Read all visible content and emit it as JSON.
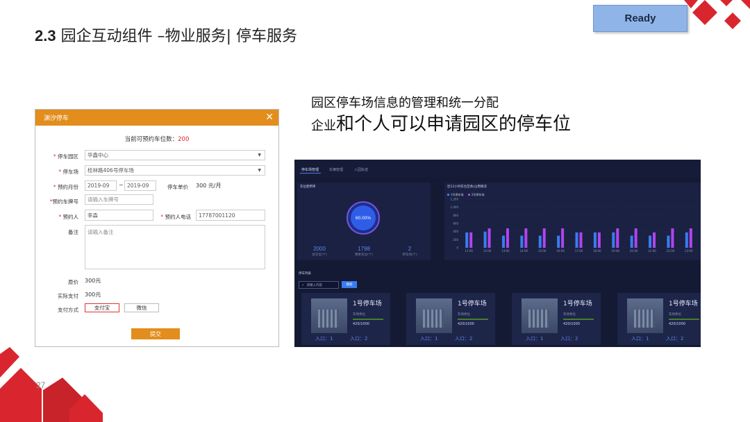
{
  "slide": {
    "title_prefix": "2.3",
    "title_text": "园企互动组件 –物业服务| 停车服务",
    "ready_label": "Ready",
    "desc_line1": "园区停车场信息的管理和统一分配",
    "desc_line2_small": "企业",
    "desc_line2_large": "和个人可以申请园区的停车位",
    "page_number": "27"
  },
  "dialog": {
    "title": "渊汐停车",
    "close": "✕",
    "available_label": "当前可预约车位数：",
    "available_count": "200",
    "park_label": "停车园区",
    "park_value": "华鑫中心",
    "lot_label": "停车场",
    "lot_value": "桂林路406号停车场",
    "month_label": "预约月份",
    "month_from": "2019-09",
    "month_sep": "~",
    "month_to": "2019-09",
    "price_label": "停车单价",
    "price_value": "300 元/月",
    "plate_label": "预约车牌号",
    "plate_placeholder": "请输入车牌号",
    "person_label": "预约人",
    "person_value": "李森",
    "phone_label": "预约人电话",
    "phone_value": "17787001120",
    "note_label": "备注",
    "note_placeholder": "请输入备注",
    "original_price_label": "原价",
    "original_price_value": "300元",
    "actual_pay_label": "实际支付",
    "actual_pay_value": "300元",
    "pay_method_label": "支付方式",
    "pay_alipay": "支付宝",
    "pay_wechat": "微信",
    "submit_label": "提交",
    "required_mark": "*"
  },
  "dashboard": {
    "tabs": [
      "停车场管理",
      "车辆管理",
      "入园轨迹"
    ],
    "usage_panel_title": "车位使用率",
    "usage_percent": "60.00%",
    "stats": [
      {
        "value": "2000",
        "label": "总车位(个)"
      },
      {
        "value": "1798",
        "label": "剩余车位(个)"
      },
      {
        "value": "2",
        "label": "停车场(个)"
      }
    ],
    "chart_title": "近12小时车位空余/占用情况",
    "list_title": "停车列表",
    "search_placeholder": "请输入内容",
    "search_button": "搜索",
    "cards": [
      {
        "name": "1号停车场",
        "sub": "车场余位",
        "value": "420/1000",
        "in": "入口：1",
        "out": "入口：2"
      },
      {
        "name": "1号停车场",
        "sub": "车场余位",
        "value": "420/1000",
        "in": "入口：1",
        "out": "入口：2"
      },
      {
        "name": "1号停车场",
        "sub": "车场余位",
        "value": "420/1000",
        "in": "入口：1",
        "out": "入口：2"
      },
      {
        "name": "1号停车场",
        "sub": "车场余位",
        "value": "420/1000",
        "in": "入口：1",
        "out": "入口：2"
      }
    ]
  },
  "chart_data": {
    "type": "bar",
    "title": "近12小时车位空余/占用情况",
    "categories": [
      "11:00",
      "12:00",
      "13:00",
      "14:00",
      "15:00",
      "16:00",
      "17:00",
      "18:00",
      "19:00",
      "20:00",
      "21:00",
      "22:00",
      "23:00"
    ],
    "series": [
      {
        "name": "1号停车场",
        "values": [
          380,
          400,
          300,
          300,
          300,
          300,
          380,
          380,
          380,
          300,
          300,
          300,
          380
        ]
      },
      {
        "name": "2号停车场",
        "values": [
          380,
          480,
          480,
          480,
          480,
          480,
          380,
          380,
          480,
          480,
          380,
          480,
          480
        ]
      }
    ],
    "yticks": [
      "1,200",
      "1,000",
      "800",
      "600",
      "400",
      "200",
      "0"
    ],
    "ylim": [
      0,
      1200
    ],
    "colors": [
      "#3a7cf0",
      "#b044f0"
    ]
  }
}
